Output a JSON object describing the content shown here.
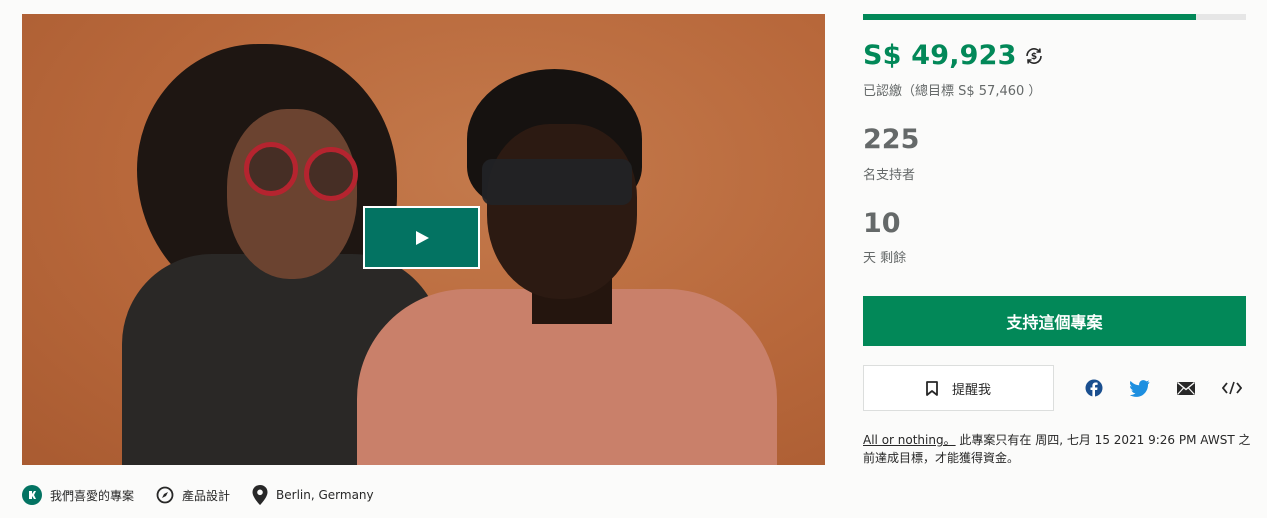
{
  "video": {
    "play_icon": "play-icon"
  },
  "meta": {
    "items": [
      {
        "icon": "projects-we-love-icon",
        "label": "我們喜愛的專案"
      },
      {
        "icon": "compass-icon",
        "label": "產品設計"
      },
      {
        "icon": "location-pin-icon",
        "label": "Berlin, Germany"
      }
    ]
  },
  "funding": {
    "progress_fraction": 0.869,
    "pledged": "S$ 49,923",
    "currency_icon": "currency-conversion-icon",
    "goal_text": "已認繳（總目標 S$ 57,460 ）"
  },
  "backers": {
    "count": "225",
    "label": "名支持者"
  },
  "days": {
    "count": "10",
    "label": "天 剩餘"
  },
  "actions": {
    "back_label": "支持這個專案",
    "remind_label": "提醒我",
    "remind_icon": "bookmark-icon"
  },
  "share": {
    "icons": [
      "facebook-icon",
      "twitter-icon",
      "email-icon",
      "embed-icon"
    ]
  },
  "terms": {
    "link_text": "All or nothing。",
    "text": " 此專案只有在 周四, 七月 15 2021 9:26 PM AWST 之前達成目標，才能獲得資金。"
  },
  "colors": {
    "accent": "#028858",
    "play_bg": "#037362",
    "muted_text": "#656969"
  }
}
